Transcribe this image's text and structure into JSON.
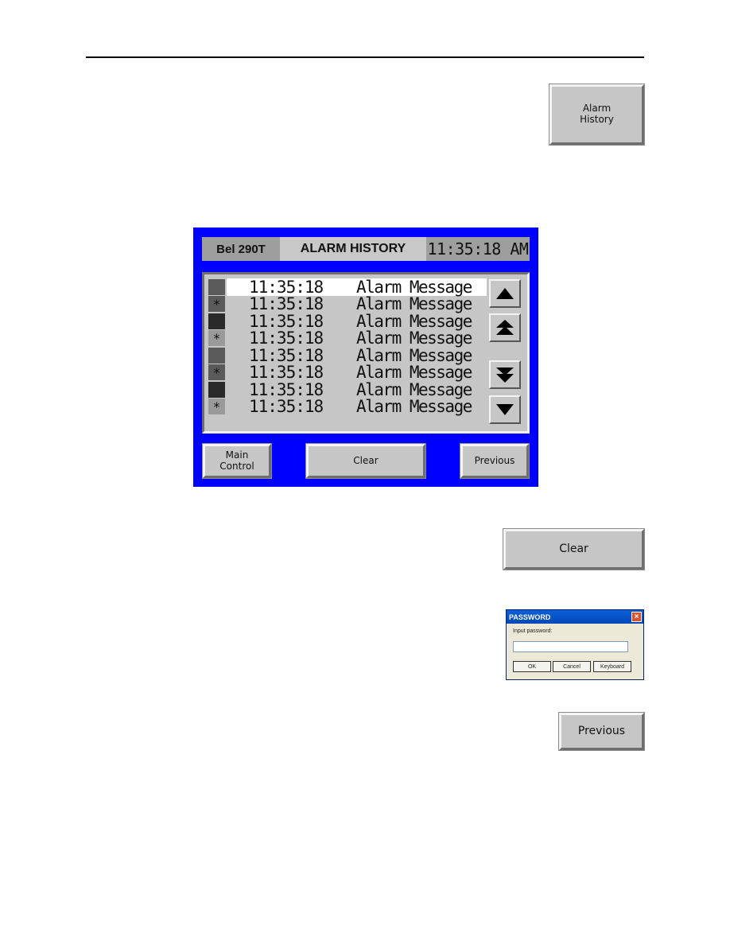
{
  "doc": {
    "alarm_history_button": {
      "line1": "Alarm",
      "line2": "History"
    },
    "clear_button": "Clear",
    "previous_button": "Previous"
  },
  "hmi": {
    "header": {
      "model": "Bel 290T",
      "title": "ALARM HISTORY",
      "clock": "11:35:18 AM"
    },
    "colors": {
      "background": "#0000ff",
      "panel": "#c6c6c6"
    },
    "alarms": [
      {
        "indicator": "medium",
        "symbol": "",
        "time": "11:35:18",
        "message": "Alarm Message",
        "selected": true
      },
      {
        "indicator": "medium",
        "symbol": "*",
        "time": "11:35:18",
        "message": "Alarm Message",
        "selected": false
      },
      {
        "indicator": "dark",
        "symbol": "",
        "time": "11:35:18",
        "message": "Alarm Message",
        "selected": false
      },
      {
        "indicator": "light",
        "symbol": "*",
        "time": "11:35:18",
        "message": "Alarm Message",
        "selected": false
      },
      {
        "indicator": "medium",
        "symbol": "",
        "time": "11:35:18",
        "message": "Alarm Message",
        "selected": false
      },
      {
        "indicator": "medium",
        "symbol": "*",
        "time": "11:35:18",
        "message": "Alarm Message",
        "selected": false
      },
      {
        "indicator": "dark",
        "symbol": "",
        "time": "11:35:18",
        "message": "Alarm Message",
        "selected": false
      },
      {
        "indicator": "light",
        "symbol": "*",
        "time": "11:35:18",
        "message": "Alarm Message",
        "selected": false
      }
    ],
    "scroll_buttons": [
      "line-up",
      "page-up",
      "page-down",
      "line-down"
    ],
    "footer": {
      "main_control_line1": "Main",
      "main_control_line2": "Control",
      "clear": "Clear",
      "previous": "Previous"
    }
  },
  "password_dialog": {
    "title": "PASSWORD",
    "close": "×",
    "label": "Input password:",
    "value": "",
    "ok": "OK",
    "cancel": "Cancel",
    "keyboard": "Keyboard"
  }
}
